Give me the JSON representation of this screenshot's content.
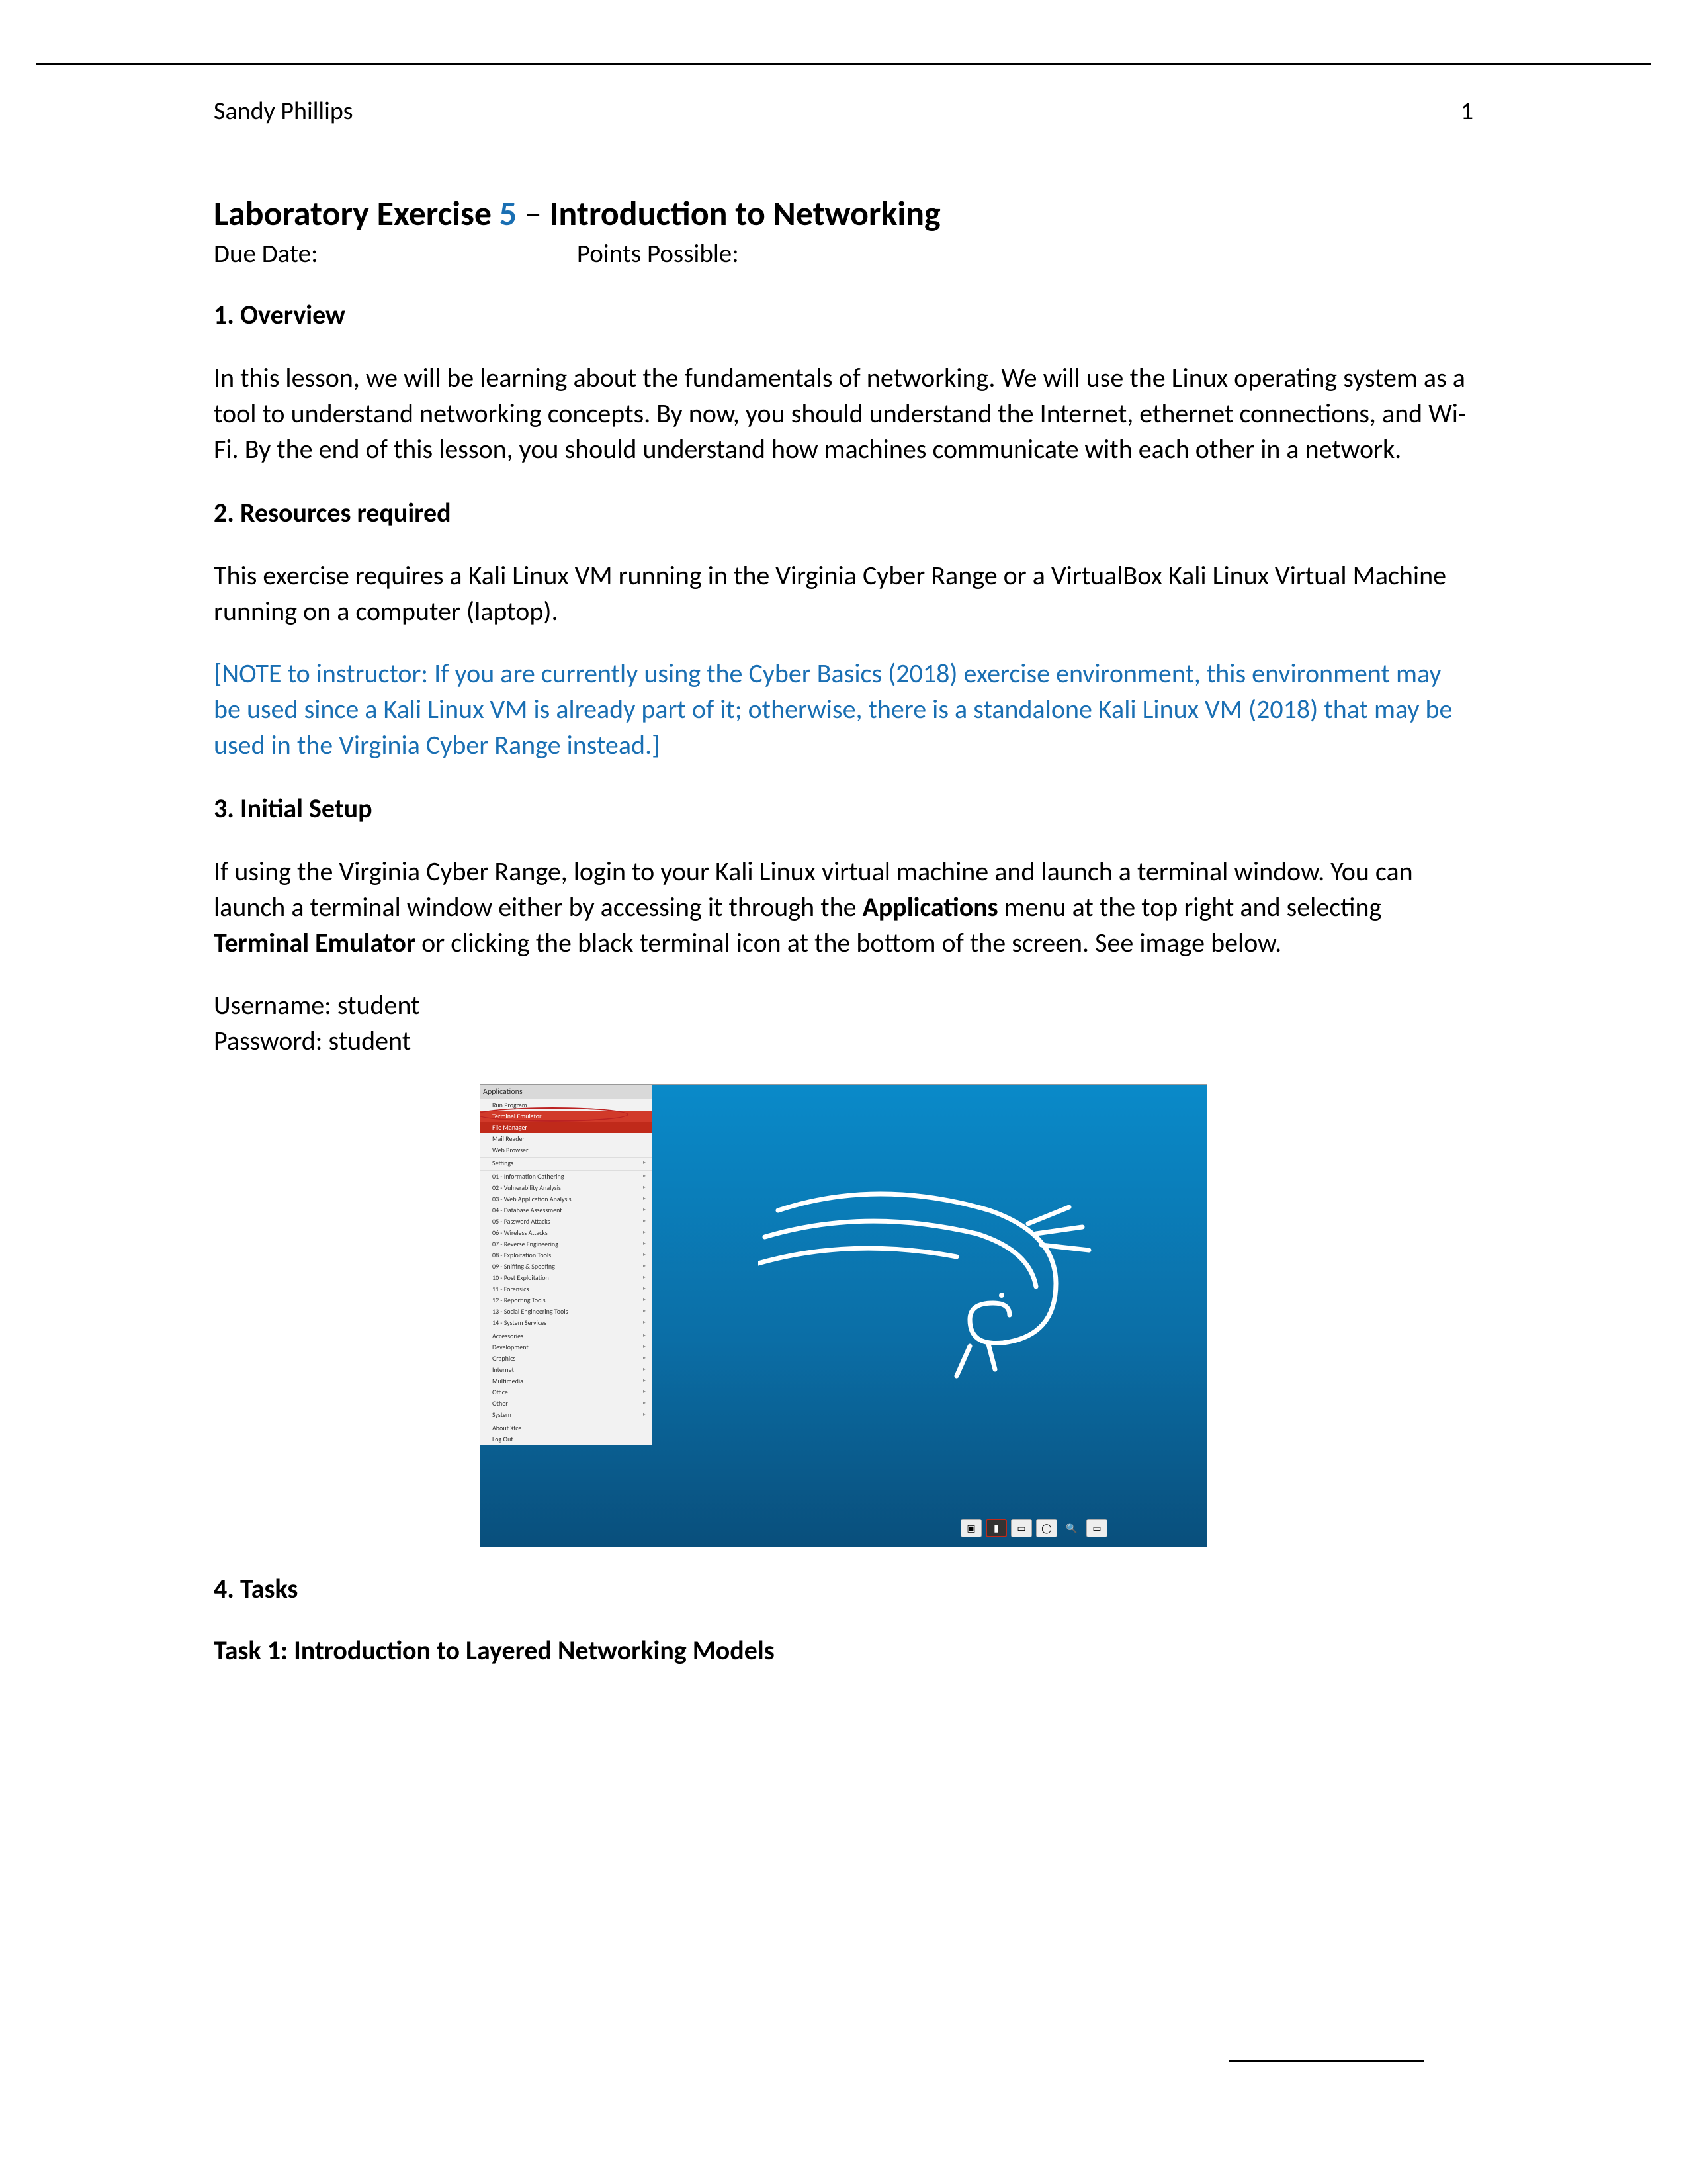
{
  "header": {
    "author": "Sandy Phillips",
    "page_num": "1"
  },
  "title": {
    "pre": "Laboratory Exercise ",
    "num": "5",
    "dash": " – ",
    "post": "Introduction to Networking"
  },
  "meta": {
    "due": "Due Date:",
    "points": "Points Possible:"
  },
  "s1": {
    "heading": "1. Overview",
    "p": "In this lesson, we will be learning about the fundamentals of networking. We will use the Linux operating system as a tool to understand networking concepts. By now, you should understand the Internet, ethernet connections, and Wi-Fi. By the end of this lesson, you should understand how machines communicate with each other in a network."
  },
  "s2": {
    "heading": "2. Resources required",
    "p": "This exercise requires a Kali Linux VM running in the Virginia Cyber Range or a VirtualBox Kali Linux Virtual Machine running on a computer (laptop).",
    "note": "[NOTE to instructor: If you are currently using the Cyber Basics (2018) exercise environment, this environment may be used since a Kali Linux VM is already part of it; otherwise, there is a standalone Kali Linux VM (2018) that may be used in the Virginia Cyber Range instead.]"
  },
  "s3": {
    "heading": "3. Initial Setup",
    "p_a": "If using the Virginia Cyber Range, login to your Kali Linux virtual machine and launch a terminal window. You can launch a terminal window either by accessing it through the ",
    "bold1": "Applications",
    "p_b": " menu at the top right and selecting ",
    "bold2": "Terminal Emulator",
    "p_c": " or clicking the black terminal icon at the bottom of the screen. See image below.",
    "user_line": "Username: student",
    "pass_line": "Password: student"
  },
  "s4": {
    "heading": "4. Tasks",
    "task1": "Task 1: Introduction to Layered Networking Models"
  },
  "kali": {
    "apps": "Applications",
    "menu": [
      "Run Program",
      "Terminal Emulator",
      "File Manager",
      "Mail Reader",
      "Web Browser",
      "Settings",
      "01 - Information Gathering",
      "02 - Vulnerability Analysis",
      "03 - Web Application Analysis",
      "04 - Database Assessment",
      "05 - Password Attacks",
      "06 - Wireless Attacks",
      "07 - Reverse Engineering",
      "08 - Exploitation Tools",
      "09 - Sniffing & Spoofing",
      "10 - Post Exploitation",
      "11 - Forensics",
      "12 - Reporting Tools",
      "13 - Social Engineering Tools",
      "14 - System Services",
      "Accessories",
      "Development",
      "Graphics",
      "Internet",
      "Multimedia",
      "Office",
      "Other",
      "System",
      "About Xfce",
      "Log Out"
    ]
  }
}
